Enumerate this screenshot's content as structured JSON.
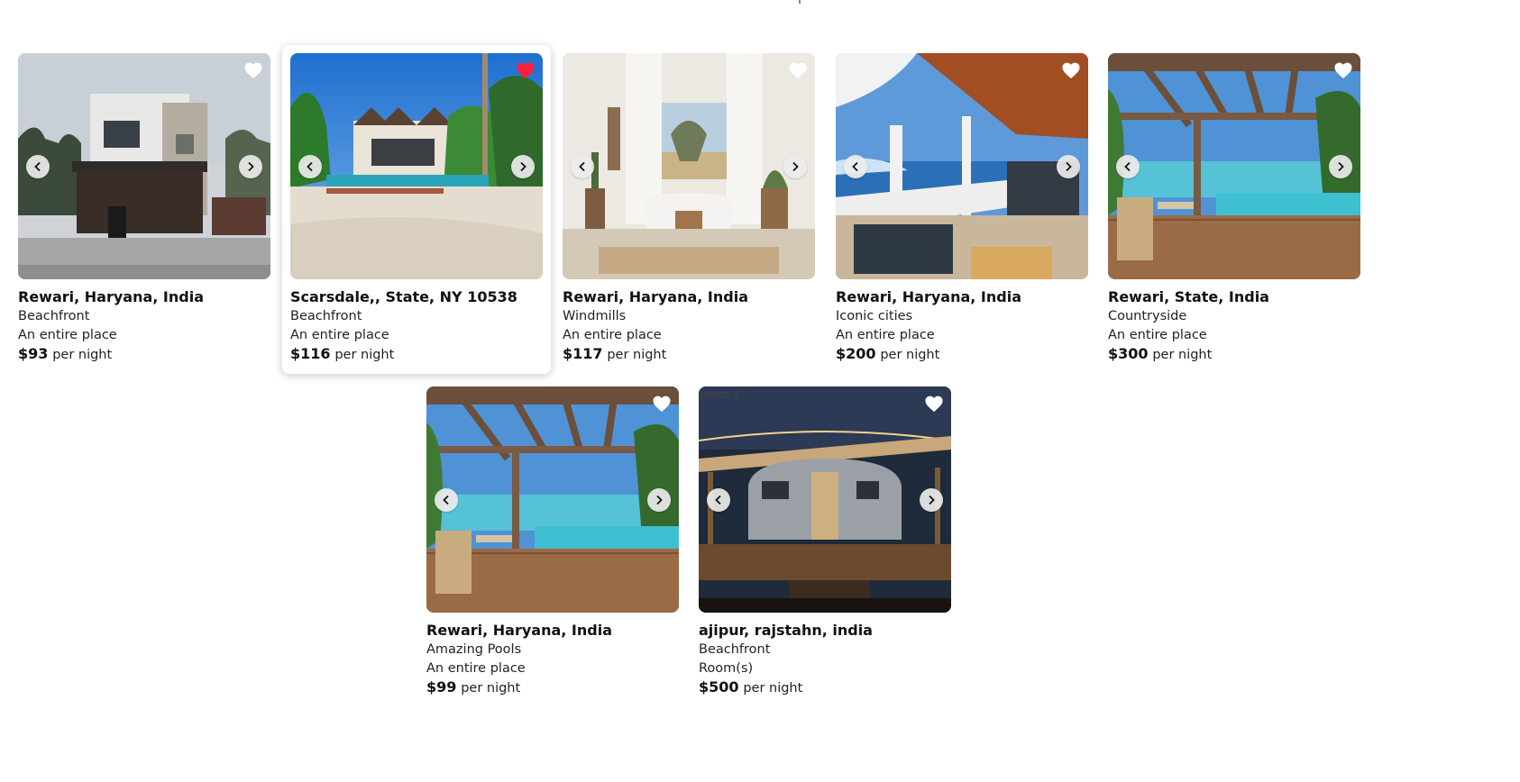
{
  "listings": [
    {
      "title": "Rewari, Haryana, India",
      "category": "Beachfront",
      "type": "An entire place",
      "price": "$93",
      "per": "per night",
      "liked": false,
      "scene": "house"
    },
    {
      "title": "Scarsdale,, State, NY 10538",
      "category": "Beachfront",
      "type": "An entire place",
      "price": "$116",
      "per": "per night",
      "liked": true,
      "scene": "resort"
    },
    {
      "title": "Rewari, Haryana, India",
      "category": "Windmills",
      "type": "An entire place",
      "price": "$117",
      "per": "per night",
      "liked": false,
      "scene": "bath"
    },
    {
      "title": "Rewari, Haryana, India",
      "category": "Iconic cities",
      "type": "An entire place",
      "price": "$200",
      "per": "per night",
      "liked": false,
      "scene": "porch"
    },
    {
      "title": "Rewari, State, India",
      "category": "Countryside",
      "type": "An entire place",
      "price": "$300",
      "per": "per night",
      "liked": false,
      "scene": "pergola"
    },
    {
      "title": "Rewari, Haryana, India",
      "category": "Amazing Pools",
      "type": "An entire place",
      "price": "$99",
      "per": "per night",
      "liked": false,
      "scene": "pergola"
    },
    {
      "title": "ajipur, rajstahn, india",
      "category": "Beachfront",
      "type": "Room(s)",
      "price": "$500",
      "per": "per night",
      "liked": false,
      "scene": "trailer",
      "broken_alt": "photo 1"
    }
  ],
  "colors": {
    "heart_liked": "#ff1f3d",
    "heart_default": "#ffffff"
  }
}
